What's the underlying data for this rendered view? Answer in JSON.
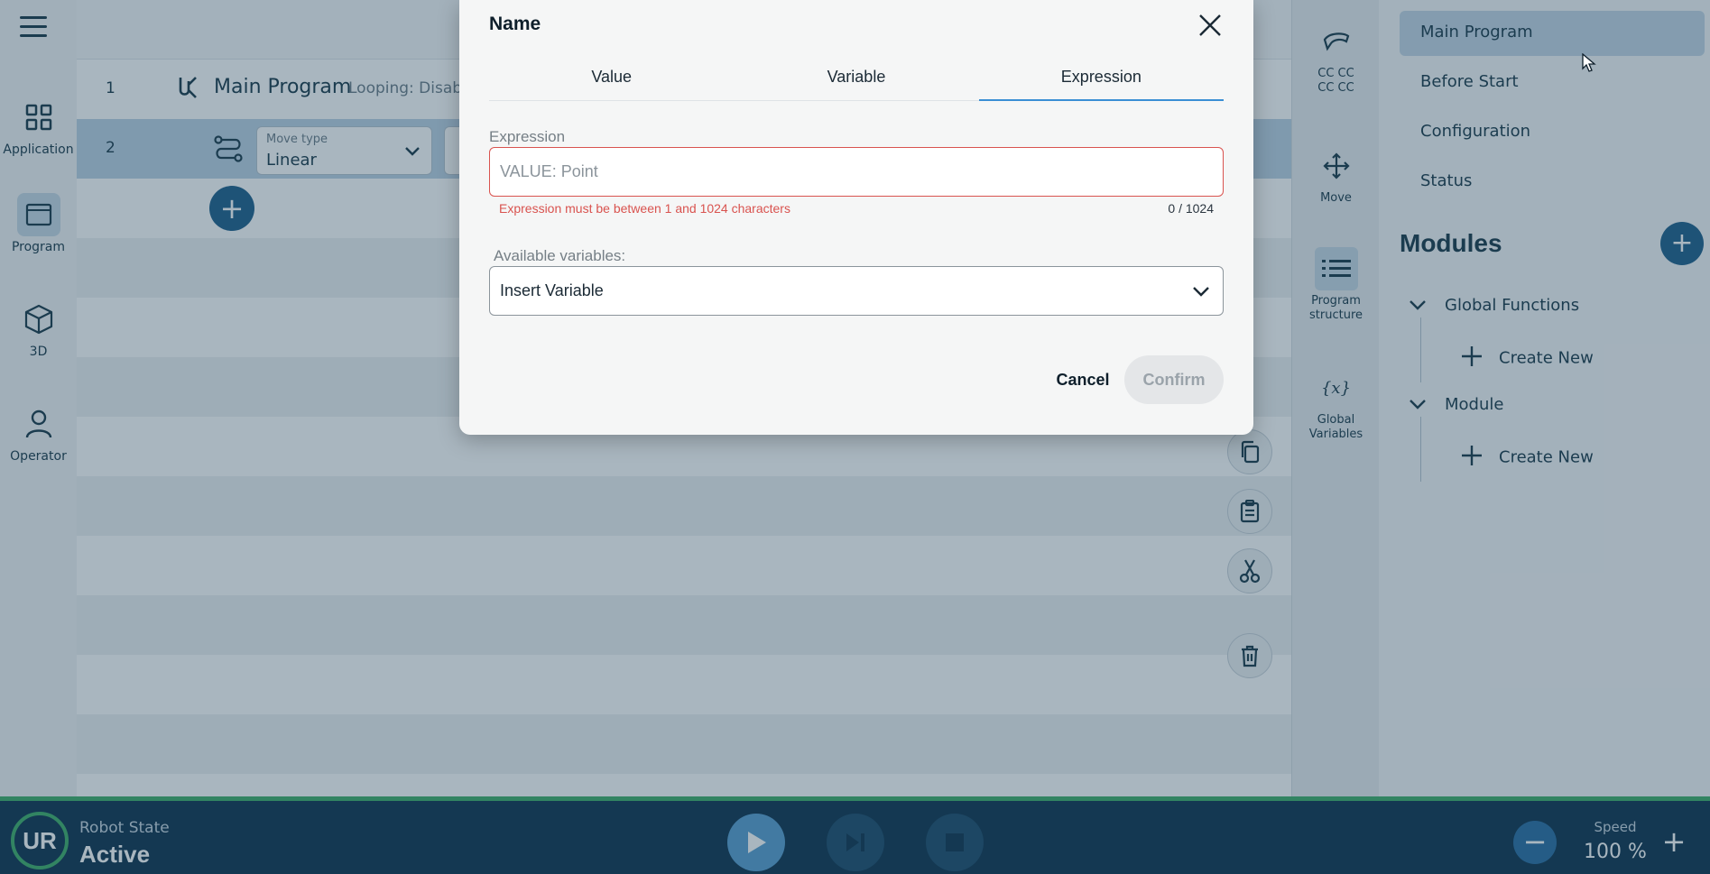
{
  "left_rail": {
    "items": [
      {
        "label": "Application",
        "icon": "grid-icon"
      },
      {
        "label": "Program",
        "icon": "program-window-icon"
      },
      {
        "label": "3D",
        "icon": "cube-icon"
      },
      {
        "label": "Operator",
        "icon": "person-icon"
      }
    ]
  },
  "editor": {
    "row1": {
      "num": "1",
      "title": "Main Program",
      "meta": "Looping:  Disab"
    },
    "row2": {
      "num": "2",
      "move_type_label": "Move type",
      "move_type_value": "Linear"
    }
  },
  "tool_rail": {
    "items": [
      {
        "label": "CC CC\nCC CC",
        "icon": "gripper-icon"
      },
      {
        "label": "Move",
        "icon": "move-arrows-icon"
      },
      {
        "label": "Program\nstructure",
        "icon": "list-icon"
      },
      {
        "label": "Global\nVariables",
        "icon": "variables-icon"
      }
    ]
  },
  "right_panel": {
    "items": [
      "Main Program",
      "Before Start",
      "Configuration",
      "Status"
    ],
    "modules_title": "Modules",
    "tree": [
      {
        "label": "Global Functions",
        "child": "Create New"
      },
      {
        "label": "Module",
        "child": "Create New"
      }
    ]
  },
  "status_bar": {
    "robot_state_label": "Robot State",
    "robot_state_value": "Active",
    "speed_label": "Speed",
    "speed_value": "100 %",
    "accent_green": "#3fae6a"
  },
  "dialog": {
    "title": "Name",
    "tabs": [
      "Value",
      "Variable",
      "Expression"
    ],
    "active_tab": "Expression",
    "expression_label": "Expression",
    "expression_placeholder": "VALUE: Point",
    "expression_value": "",
    "error_text": "Expression must be between 1 and 1024 characters",
    "char_count": "0 / 1024",
    "available_vars_label": "Available variables:",
    "insert_variable": "Insert Variable",
    "cancel_label": "Cancel",
    "confirm_label": "Confirm",
    "error_color": "#d9534f",
    "tab_accent": "#3a8fd4"
  }
}
